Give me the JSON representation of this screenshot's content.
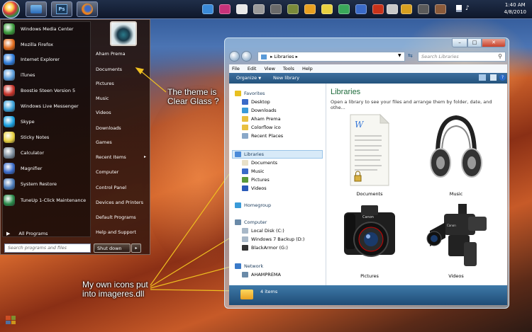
{
  "taskbar": {
    "clock_time": "1:40 AM",
    "clock_date": "4/8/2010",
    "ps_label": "Ps"
  },
  "start_menu": {
    "left_items": [
      {
        "label": "Windows Media Center",
        "color": "#3b9a3b"
      },
      {
        "label": "Mozilla Firefox",
        "color": "#e06a1c"
      },
      {
        "label": "Internet Explorer",
        "color": "#2f7bd8"
      },
      {
        "label": "iTunes",
        "color": "#5a9ad8"
      },
      {
        "label": "Boostie Steen Version 5",
        "color": "#c8332a"
      },
      {
        "label": "Windows Live Messenger",
        "color": "#3aa0d8"
      },
      {
        "label": "Skype",
        "color": "#1aa0e0"
      },
      {
        "label": "Sticky Notes",
        "color": "#e8d040"
      },
      {
        "label": "Calculator",
        "color": "#7a8a9a"
      },
      {
        "label": "Magnifier",
        "color": "#3a6ac8"
      },
      {
        "label": "System Restore",
        "color": "#4a7ab8"
      },
      {
        "label": "TuneUp 1-Click Maintenance",
        "color": "#2a8a4a"
      }
    ],
    "all_programs": "All Programs",
    "right_items": [
      "Aham Prema",
      "Documents",
      "Pictures",
      "Music",
      "Videos",
      "Downloads",
      "Games",
      "Recent Items",
      "Computer",
      "Control Panel",
      "Devices and Printers",
      "Default Programs",
      "Help and Support"
    ],
    "search_placeholder": "Search programs and files",
    "shutdown_label": "Shut down"
  },
  "annotations": {
    "theme_line1": "The theme is",
    "theme_line2": "Clear Glass ?",
    "icons_line1": "My own icons put",
    "icons_line2": "into imageres.dll"
  },
  "explorer": {
    "address": "Libraries",
    "search_placeholder": "Search Libraries",
    "menu": [
      "File",
      "Edit",
      "View",
      "Tools",
      "Help"
    ],
    "organize": "Organize",
    "new_library": "New library",
    "nav": {
      "favorites": "Favorites",
      "favorite_items": [
        "Desktop",
        "Downloads",
        "Aham Prema",
        "Colorflow ico",
        "Recent Places"
      ],
      "libraries": "Libraries",
      "library_items": [
        "Documents",
        "Music",
        "Pictures",
        "Videos"
      ],
      "homegroup": "Homegroup",
      "computer": "Computer",
      "drives": [
        "Local Disk (C:)",
        "Windows 7 Backup (D:)",
        "BlackArmor (G:)"
      ],
      "network": "Network",
      "network_items": [
        "AHAMPREMA"
      ]
    },
    "content_title": "Libraries",
    "content_subtitle": "Open a library to see your files and arrange them by folder, date, and othe...",
    "libraries": [
      "Documents",
      "Music",
      "Pictures",
      "Videos"
    ],
    "status": "4 items"
  }
}
